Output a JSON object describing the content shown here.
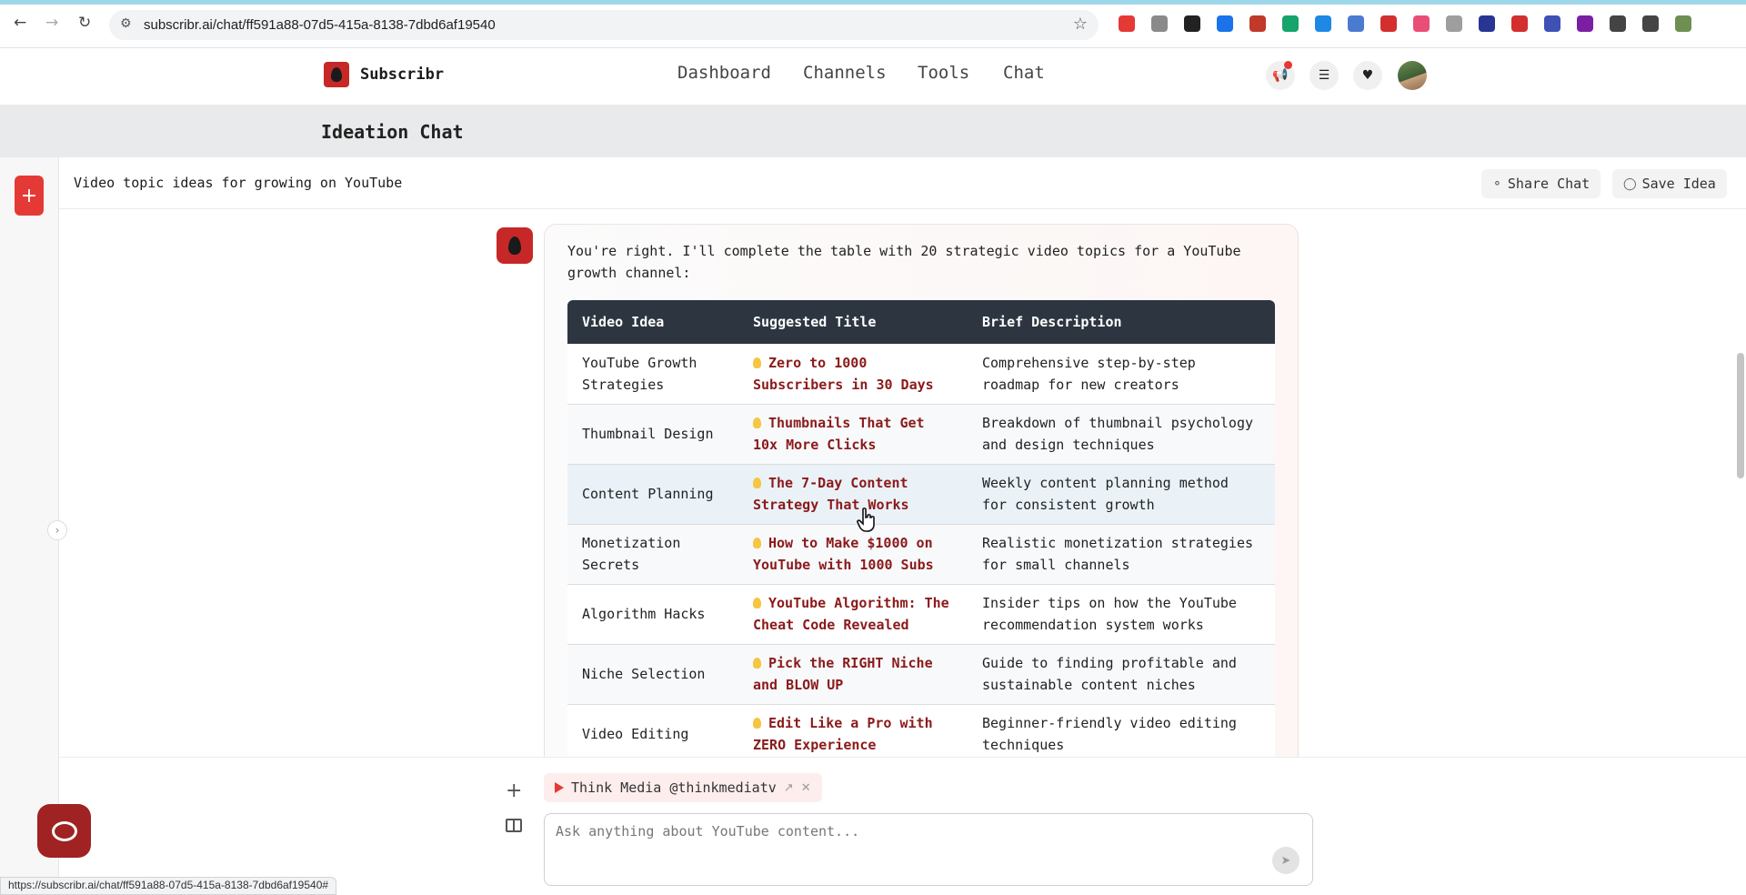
{
  "browser": {
    "url": "subscribr.ai/chat/ff591a88-07d5-415a-8138-7dbd6af19540",
    "extensions": [
      {
        "name": "pen-icon",
        "color": "#e53935"
      },
      {
        "name": "moon-icon",
        "color": "#8a8a8a"
      },
      {
        "name": "bag-icon",
        "color": "#222222"
      },
      {
        "name": "circle-blue-icon",
        "color": "#1a73e8"
      },
      {
        "name": "desc-icon",
        "color": "#c0392b"
      },
      {
        "name": "grammarly-icon",
        "color": "#15a46b"
      },
      {
        "name": "m-logo-icon",
        "color": "#1e88e5"
      },
      {
        "name": "doc-icon",
        "color": "#4a7bd0"
      },
      {
        "name": "red-circle-icon",
        "color": "#d32f2f"
      },
      {
        "name": "pink-circle-icon",
        "color": "#e94e77"
      },
      {
        "name": "notes-icon",
        "color": "#9e9e9e"
      },
      {
        "name": "m-square-icon",
        "color": "#283593"
      },
      {
        "name": "v-icon",
        "color": "#d32f2f"
      },
      {
        "name": "spark-icon",
        "color": "#3f51b5"
      },
      {
        "name": "gear-purple-icon",
        "color": "#7b1fa2"
      },
      {
        "name": "puzzle-icon",
        "color": "#444444"
      },
      {
        "name": "queue-icon",
        "color": "#444444"
      },
      {
        "name": "profile-icon",
        "color": "#6d8f52"
      }
    ],
    "status_url": "https://subscribr.ai/chat/ff591a88-07d5-415a-8138-7dbd6af19540#"
  },
  "app": {
    "brand": "Subscribr",
    "nav": [
      "Dashboard",
      "Channels",
      "Tools",
      "Chat"
    ],
    "accent": "#c62828"
  },
  "page": {
    "title": "Ideation Chat"
  },
  "chat": {
    "topic": "Video topic ideas for growing on YouTube",
    "share_label": "Share Chat",
    "save_label": "Save Idea"
  },
  "message": {
    "intro": "You're right. I'll complete the table with 20 strategic video topics for a YouTube growth channel:",
    "columns": [
      "Video Idea",
      "Suggested Title",
      "Brief Description"
    ],
    "rows": [
      {
        "idea": "YouTube Growth Strategies",
        "title": "Zero to 1000 Subscribers in 30 Days",
        "desc": "Comprehensive step-by-step roadmap for new creators"
      },
      {
        "idea": "Thumbnail Design",
        "title": "Thumbnails That Get 10x More Clicks",
        "desc": "Breakdown of thumbnail psychology and design techniques"
      },
      {
        "idea": "Content Planning",
        "title": "The 7-Day Content Strategy That Works",
        "desc": "Weekly content planning method for consistent growth"
      },
      {
        "idea": "Monetization Secrets",
        "title": "How to Make $1000 on YouTube with 1000 Subs",
        "desc": "Realistic monetization strategies for small channels"
      },
      {
        "idea": "Algorithm Hacks",
        "title": "YouTube Algorithm: The Cheat Code Revealed",
        "desc": "Insider tips on how the YouTube recommendation system works"
      },
      {
        "idea": "Niche Selection",
        "title": "Pick the RIGHT Niche and BLOW UP",
        "desc": "Guide to finding profitable and sustainable content niches"
      },
      {
        "idea": "Video Editing",
        "title": "Edit Like a Pro with ZERO Experience",
        "desc": "Beginner-friendly video editing techniques"
      }
    ]
  },
  "composer": {
    "channel_chip": "Think Media @thinkmediatv",
    "placeholder": "Ask anything about YouTube content..."
  }
}
